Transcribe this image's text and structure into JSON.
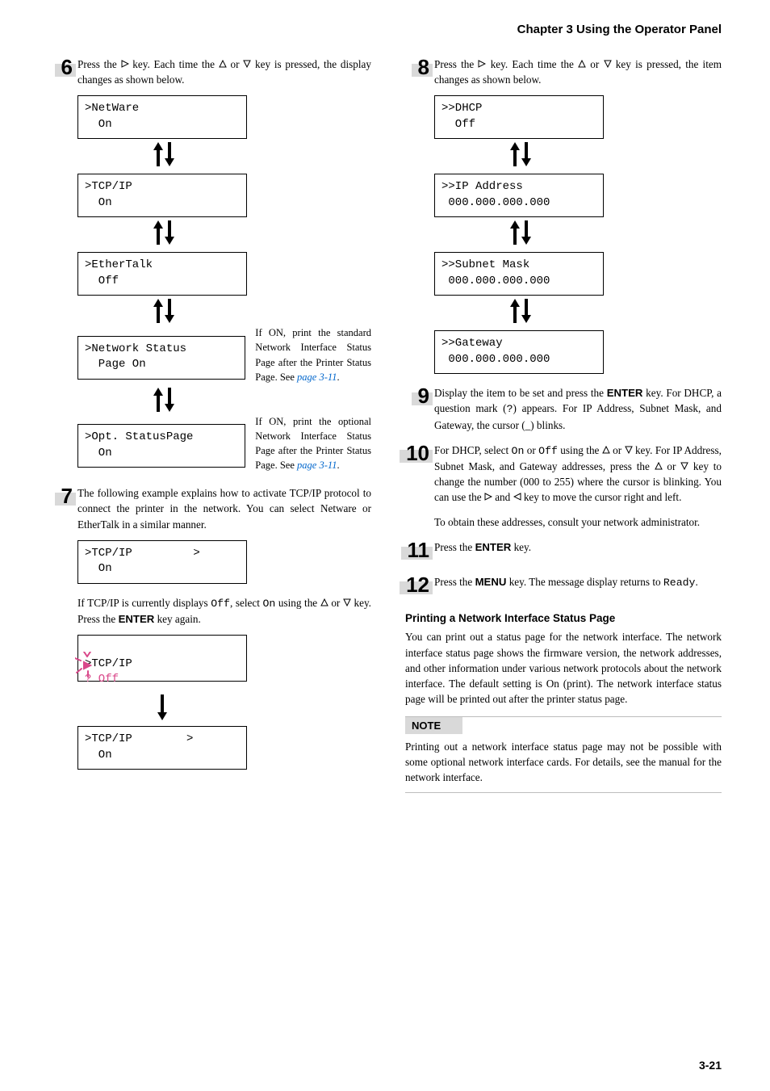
{
  "chapter": "Chapter 3  Using the Operator Panel",
  "pageNumber": "3-21",
  "left": {
    "step6": {
      "num": "6",
      "text_a": "Press the ",
      "text_b": " key. Each time the ",
      "text_c": " or ",
      "text_d": " key is pressed, the display changes as shown below."
    },
    "displays": {
      "d1l1": ">NetWare",
      "d1l2": "  On",
      "d2l1": ">TCP/IP",
      "d2l2": "  On",
      "d3l1": ">EtherTalk",
      "d3l2": "  Off",
      "d4l1": ">Network Status",
      "d4l2": "  Page On",
      "d5l1": ">Opt. StatusPage",
      "d5l2": "  On"
    },
    "sideNote1_a": "If ON, print the standard Network Interface Status Page after the Printer Status Page. See ",
    "sideNote1_link": "page 3-11",
    "sideNote1_b": ".",
    "sideNote2_a": "If ON, print the optional Network Interface Status Page after the Printer Status Page. See ",
    "sideNote2_link": "page 3-11",
    "sideNote2_b": ".",
    "step7": {
      "num": "7",
      "text": "The following example explains how to activate TCP/IP protocol to connect the printer in the network. You can select Netware or EtherTalk in a similar manner."
    },
    "tcpBox1_l1": ">TCP/IP         >",
    "tcpBox1_l2": "  On",
    "tcpMid_a": "If TCP/IP is currently displays ",
    "tcpMid_off": "Off",
    "tcpMid_b": ", select ",
    "tcpMid_on": "On",
    "tcpMid_c": " using the ",
    "tcpMid_d": " or ",
    "tcpMid_e": " key. Press the ",
    "tcpMid_enter": "ENTER",
    "tcpMid_f": " key again.",
    "tcpBox2_l1": ">TCP/IP",
    "tcpBox2_l2": "? Off",
    "tcpBox3_l1": ">TCP/IP        >",
    "tcpBox3_l2": "  On"
  },
  "right": {
    "step8": {
      "num": "8",
      "text_a": "Press the ",
      "text_b": " key. Each time the ",
      "text_c": " or ",
      "text_d": " key is pressed, the item changes as shown below."
    },
    "displays": {
      "d1l1": ">>DHCP",
      "d1l2": "  Off",
      "d2l1": ">>IP Address",
      "d2l2": " 000.000.000.000",
      "d3l1": ">>Subnet Mask",
      "d3l2": " 000.000.000.000",
      "d4l1": ">>Gateway",
      "d4l2": " 000.000.000.000"
    },
    "step9": {
      "num": "9",
      "text_a": "Display the item to be set and press the ",
      "enter": "ENTER",
      "text_b": " key. For DHCP, a question mark (",
      "q": "?",
      "text_c": ") appears. For IP Address, Subnet Mask, and Gateway, the cursor (_) blinks."
    },
    "step10": {
      "num": "10",
      "text_a": "For DHCP, select ",
      "on": "On",
      "text_b": " or ",
      "off": "Off",
      "text_c": " using the ",
      "text_d": " or ",
      "text_e": " key. For IP Address, Subnet Mask, and Gateway addresses, press the ",
      "text_f": " or ",
      "text_g": " key to change the number (000 to 255) where the cursor is blinking. You can use the ",
      "text_h": " and ",
      "text_i": " key to move the cursor right and left.",
      "para2": "To obtain these addresses, consult your network administrator."
    },
    "step11": {
      "num": "11",
      "text_a": "Press the ",
      "enter": "ENTER",
      "text_b": " key."
    },
    "step12": {
      "num": "12",
      "text_a": "Press the ",
      "menu": "MENU",
      "text_b": " key. The message display returns to ",
      "ready": "Ready",
      "text_c": "."
    },
    "sectionHeading": "Printing a Network Interface Status Page",
    "sectionPara": "You can print out a status page for the network interface. The network interface status page shows the firmware version, the network addresses, and other information under various network protocols about the network interface. The default setting is On (print). The network interface status page will be printed out after the printer status page.",
    "noteLabel": "NOTE",
    "notePara": "Printing out a network interface status page may not be possible with some optional network interface cards. For details, see the manual for the network interface."
  }
}
